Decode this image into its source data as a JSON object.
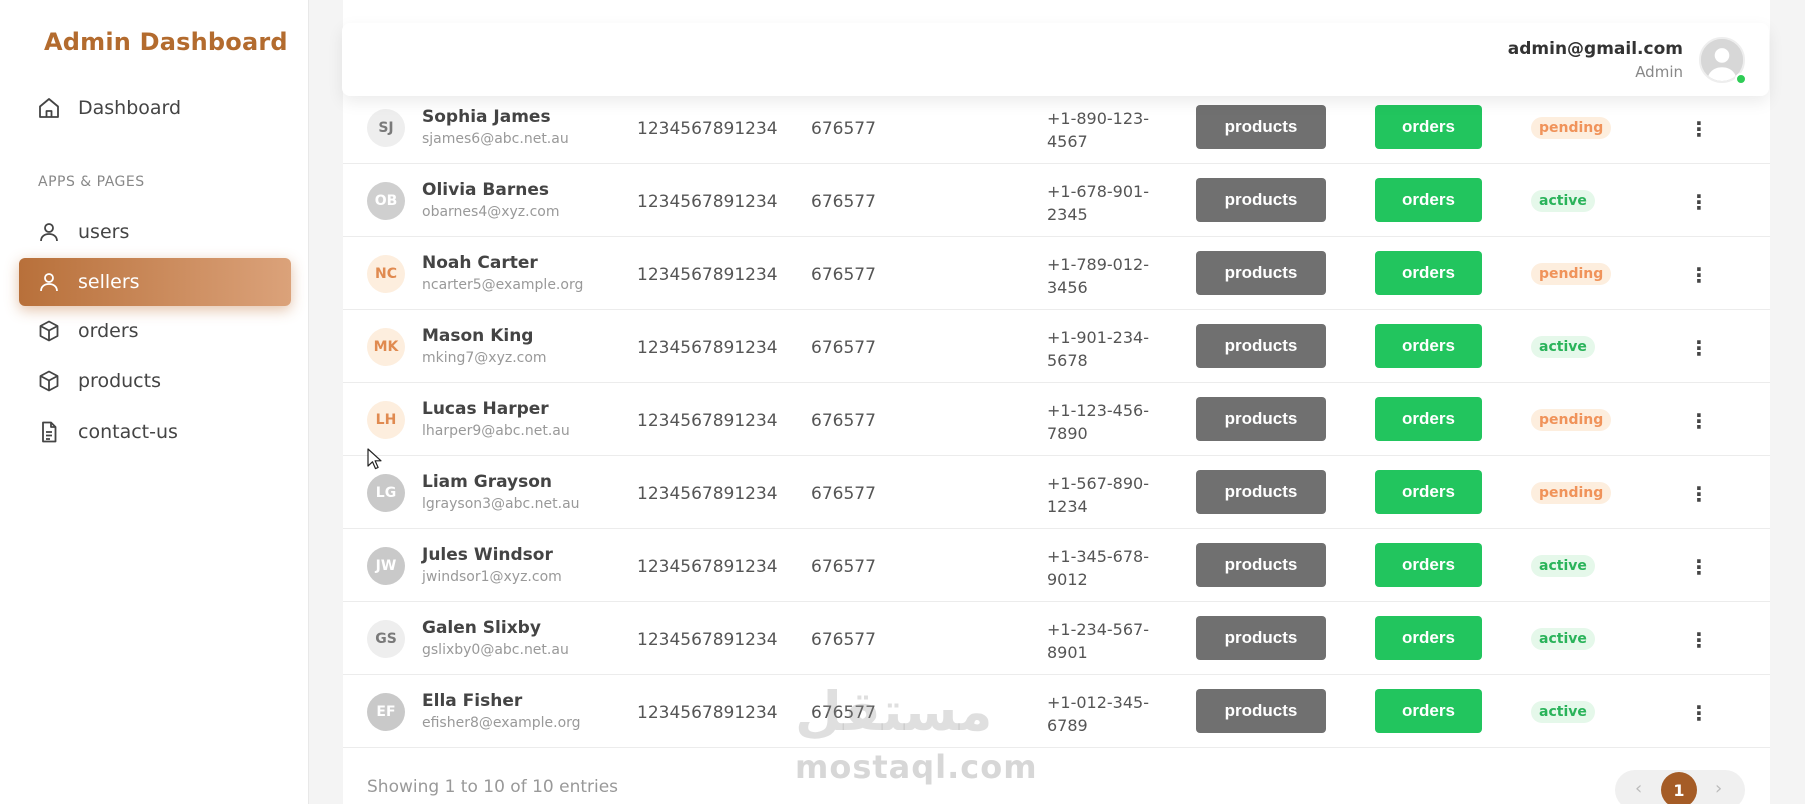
{
  "sidebar": {
    "brand": "Admin Dashboard",
    "dashboard_label": "Dashboard",
    "section_label": "APPS & PAGES",
    "items": [
      {
        "label": "users",
        "icon": "user-icon",
        "active": false
      },
      {
        "label": "sellers",
        "icon": "user-icon",
        "active": true
      },
      {
        "label": "orders",
        "icon": "box-icon",
        "active": false
      },
      {
        "label": "products",
        "icon": "box-icon",
        "active": false
      },
      {
        "label": "contact-us",
        "icon": "document-icon",
        "active": false
      }
    ]
  },
  "header": {
    "email": "admin@gmail.com",
    "role": "Admin",
    "online": true
  },
  "table": {
    "rows": [
      {
        "initials": "SJ",
        "name": "Sophia James",
        "email": "sjames6@abc.net.au",
        "id": "1234567891234",
        "code": "676577",
        "phone": "+1-890-123-4567",
        "products_label": "products",
        "orders_label": "orders",
        "status": "pending"
      },
      {
        "initials": "OB",
        "name": "Olivia Barnes",
        "email": "obarnes4@xyz.com",
        "id": "1234567891234",
        "code": "676577",
        "phone": "+1-678-901-2345",
        "products_label": "products",
        "orders_label": "orders",
        "status": "active"
      },
      {
        "initials": "NC",
        "name": "Noah Carter",
        "email": "ncarter5@example.org",
        "id": "1234567891234",
        "code": "676577",
        "phone": "+1-789-012-3456",
        "products_label": "products",
        "orders_label": "orders",
        "status": "pending"
      },
      {
        "initials": "MK",
        "name": "Mason King",
        "email": "mking7@xyz.com",
        "id": "1234567891234",
        "code": "676577",
        "phone": "+1-901-234-5678",
        "products_label": "products",
        "orders_label": "orders",
        "status": "active"
      },
      {
        "initials": "LH",
        "name": "Lucas Harper",
        "email": "lharper9@abc.net.au",
        "id": "1234567891234",
        "code": "676577",
        "phone": "+1-123-456-7890",
        "products_label": "products",
        "orders_label": "orders",
        "status": "pending"
      },
      {
        "initials": "LG",
        "name": "Liam Grayson",
        "email": "lgrayson3@abc.net.au",
        "id": "1234567891234",
        "code": "676577",
        "phone": "+1-567-890-1234",
        "products_label": "products",
        "orders_label": "orders",
        "status": "pending"
      },
      {
        "initials": "JW",
        "name": "Jules Windsor",
        "email": "jwindsor1@xyz.com",
        "id": "1234567891234",
        "code": "676577",
        "phone": "+1-345-678-9012",
        "products_label": "products",
        "orders_label": "orders",
        "status": "active"
      },
      {
        "initials": "GS",
        "name": "Galen Slixby",
        "email": "gslixby0@abc.net.au",
        "id": "1234567891234",
        "code": "676577",
        "phone": "+1-234-567-8901",
        "products_label": "products",
        "orders_label": "orders",
        "status": "active"
      },
      {
        "initials": "EF",
        "name": "Ella Fisher",
        "email": "efisher8@example.org",
        "id": "1234567891234",
        "code": "676577",
        "phone": "+1-012-345-6789",
        "products_label": "products",
        "orders_label": "orders",
        "status": "active"
      }
    ]
  },
  "footer": {
    "entries_text": "Showing 1 to 10 of 10 entries",
    "current_page": "1"
  },
  "watermark": {
    "arabic": "مستقل",
    "latin": "mostaql.com"
  },
  "colors": {
    "brand": "#b36b2e",
    "active_nav": "#c27a45",
    "products_button": "#707070",
    "orders_button": "#22c55e",
    "pending_text": "#f0935a",
    "active_text": "#2ab35a",
    "pager_current": "#a55c26"
  },
  "avatar_palettes": [
    {
      "bg": "#eeeeee",
      "fg": "#7a7a7a"
    },
    {
      "bg": "#cfcfcf",
      "fg": "#ffffff"
    },
    {
      "bg": "#fdeede",
      "fg": "#e08a50"
    },
    {
      "bg": "#c9c9c9",
      "fg": "#ffffff"
    },
    {
      "bg": "#eeeeee",
      "fg": "#7a7a7a"
    }
  ],
  "row_avatar_palette": [
    0,
    1,
    2,
    2,
    2,
    3,
    3,
    0,
    3
  ]
}
